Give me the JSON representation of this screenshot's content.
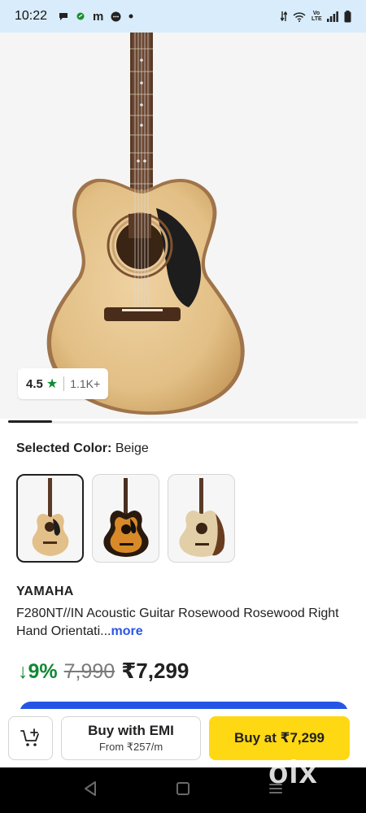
{
  "status_bar": {
    "time": "10:22",
    "left_icons": [
      "chat-bubble-icon",
      "leaf-icon",
      "m-app-icon",
      "message-icon",
      "dot-icon"
    ],
    "right_icons": [
      "data-arrows-icon",
      "wifi-icon",
      "volte-icon",
      "signal-icon",
      "battery-icon"
    ],
    "volte_text": "Vo LTE"
  },
  "product": {
    "rating": "4.5",
    "rating_count": "1.1K+",
    "selected_color_label": "Selected Color:",
    "selected_color_value": "Beige",
    "color_options": [
      {
        "name": "beige",
        "selected": true
      },
      {
        "name": "sunburst",
        "selected": false
      },
      {
        "name": "natural-dark-side",
        "selected": false
      }
    ],
    "brand": "YAMAHA",
    "title": "F280NT//IN Acoustic Guitar Rosewood Rosewood Right Hand Orientati...",
    "more_label": "more",
    "discount": "9%",
    "mrp": "7,990",
    "price": "₹7,299"
  },
  "bottom_bar": {
    "emi_label": "Buy with EMI",
    "emi_sub": "From ₹257/m",
    "buy_label": "Buy at ₹7,299"
  },
  "watermark": "olx",
  "colors": {
    "accent_blue": "#2455e5",
    "discount_green": "#108934",
    "buy_yellow": "#ffd814",
    "status_bar_bg": "#d8ecfb"
  }
}
